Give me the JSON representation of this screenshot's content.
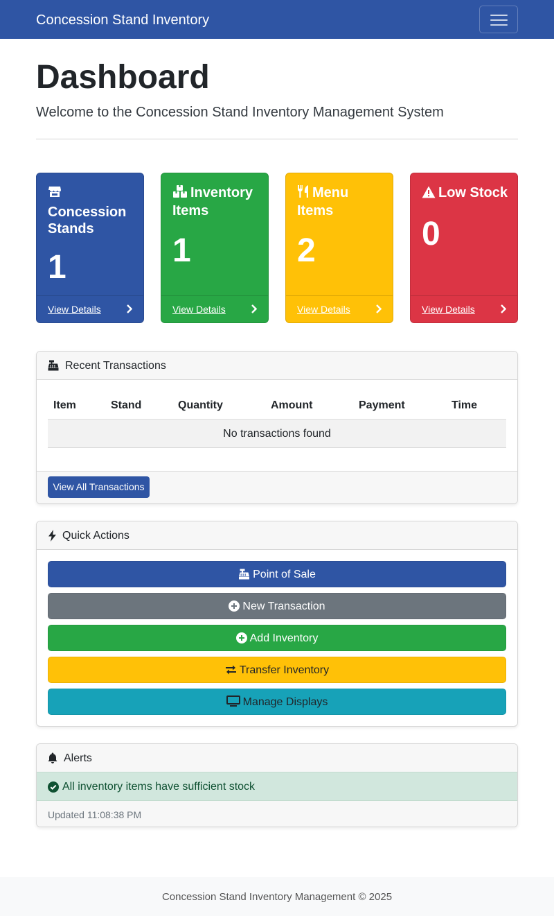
{
  "navbar": {
    "brand": "Concession Stand Inventory",
    "toggle_icon": "hamburger-icon"
  },
  "header": {
    "title": "Dashboard",
    "subtitle": "Welcome to the Concession Stand Inventory Management System"
  },
  "stats": [
    {
      "title": "Concession Stands",
      "value": "1",
      "link": "View Details",
      "icon": "store-icon",
      "color": "#2f55a4"
    },
    {
      "title": "Inventory Items",
      "value": "1",
      "link": "View Details",
      "icon": "boxes-icon",
      "color": "#28a745"
    },
    {
      "title": "Menu Items",
      "value": "2",
      "link": "View Details",
      "icon": "utensils-icon",
      "color": "#ffc107"
    },
    {
      "title": "Low Stock",
      "value": "0",
      "link": "View Details",
      "icon": "warning-icon",
      "color": "#dc3545"
    }
  ],
  "transactions": {
    "header": "Recent Transactions",
    "icon": "cash-register-icon",
    "columns": [
      "Item",
      "Stand",
      "Quantity",
      "Amount",
      "Payment",
      "Time"
    ],
    "empty_text": "No transactions found",
    "view_all": "View All Transactions"
  },
  "quick_actions": {
    "header": "Quick Actions",
    "icon": "bolt-icon",
    "buttons": [
      {
        "label": "Point of Sale",
        "icon": "cash-register-icon",
        "color": "#2f55a4"
      },
      {
        "label": "New Transaction",
        "icon": "plus-circle-icon",
        "color": "#6c757d"
      },
      {
        "label": "Add Inventory",
        "icon": "plus-circle-icon",
        "color": "#28a745"
      },
      {
        "label": "Transfer Inventory",
        "icon": "exchange-icon",
        "color": "#ffc107"
      },
      {
        "label": "Manage Displays",
        "icon": "monitor-icon",
        "color": "#17a2b8"
      }
    ]
  },
  "alerts": {
    "header": "Alerts",
    "icon": "bell-icon",
    "message": "All inventory items have sufficient stock",
    "updated": "Updated 11:08:38 PM"
  },
  "footer": {
    "text": "Concession Stand Inventory Management © 2025"
  }
}
